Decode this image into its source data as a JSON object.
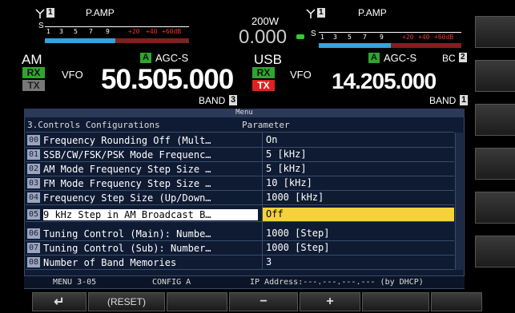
{
  "vfo_main": {
    "meter_label": "P.AMP",
    "s_label": "S",
    "meter_ticks": [
      "1",
      "3",
      "5",
      "7",
      "9",
      "+20",
      "+40",
      "+60dB"
    ],
    "mode": "AM",
    "rx": "RX",
    "tx": "TX",
    "vfo_label": "VFO",
    "agc_badge": "A",
    "agc_label": "AGC-S",
    "frequency": "50.505.000",
    "band_label": "BAND",
    "band_num": "3"
  },
  "center": {
    "power": "200W",
    "tx_freq_digits": "0.000"
  },
  "vfo_sub": {
    "meter_label": "P.AMP",
    "s_label": "S",
    "meter_ticks": [
      "1",
      "3",
      "5",
      "7",
      "9",
      "+20",
      "+40",
      "+60dB"
    ],
    "mode": "USB",
    "rx": "RX",
    "tx": "TX",
    "vfo_label": "VFO",
    "agc_badge": "A",
    "agc_label": "AGC-S",
    "bc_label": "BC",
    "bc_num": "2",
    "frequency": "14.205.000",
    "band_label": "BAND",
    "band_num": "1"
  },
  "menu": {
    "title": "Menu",
    "section": "3.Controls Configurations",
    "param_header": "Parameter",
    "rows": [
      {
        "num": "00",
        "title": "Frequency Rounding Off (Mult…",
        "value": "On"
      },
      {
        "num": "01",
        "title": "SSB/CW/FSK/PSK Mode Frequenc…",
        "value": "5 [kHz]"
      },
      {
        "num": "02",
        "title": "AM Mode Frequency Step Size …",
        "value": "5 [kHz]"
      },
      {
        "num": "03",
        "title": "FM Mode Frequency Step Size …",
        "value": "10 [kHz]"
      },
      {
        "num": "04",
        "title": "Frequency Step Size (Up/Down…",
        "value": "1000 [kHz]"
      },
      {
        "num": "05",
        "title": "9 kHz Step in AM Broadcast B…",
        "value": "Off"
      },
      {
        "num": "06",
        "title": "Tuning Control (Main): Numbe…",
        "value": "1000 [Step]"
      },
      {
        "num": "07",
        "title": "Tuning Control (Sub): Number…",
        "value": "1000 [Step]"
      },
      {
        "num": "08",
        "title": "Number of Band Memories",
        "value": "3"
      }
    ],
    "status": {
      "menu_no": "MENU 3-05",
      "config": "CONFIG A",
      "ip": "IP Address:---.---.---.--- (by DHCP)"
    }
  },
  "softkeys": {
    "back": "↵",
    "reset": "(RESET)",
    "minus": "−",
    "plus": "+"
  },
  "colors": {
    "menu_bg": "#0f1b33",
    "selected_value": "#f5d23a",
    "rx_green": "#2fa52f",
    "tx_red": "#d22222",
    "meter_blue": "#35a4d8"
  }
}
